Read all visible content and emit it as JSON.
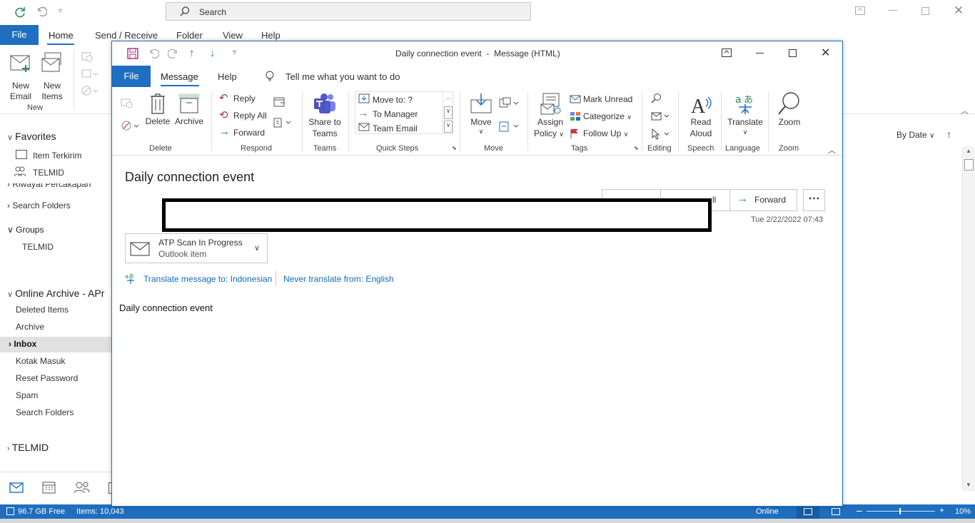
{
  "main": {
    "search_placeholder": "Search",
    "tabs": {
      "file": "File",
      "home": "Home",
      "send_receive": "Send / Receive",
      "folder": "Folder",
      "view": "View",
      "help": "Help"
    },
    "ribbon": {
      "new_email": [
        "New",
        "Email"
      ],
      "new_items": [
        "New",
        "Items"
      ],
      "group_new": "New"
    },
    "sort_label": "By Date"
  },
  "sidebar": {
    "favorites": "Favorites",
    "fav_items": [
      "Item Terkirim",
      "TELMID"
    ],
    "partial_item": "Riwayat Percakapan",
    "search_folders": "Search Folders",
    "groups": "Groups",
    "group_items": [
      "TELMID"
    ],
    "archive": "Online Archive - APr",
    "archive_items": [
      "Deleted Items",
      "Archive",
      "Inbox",
      "Kotak Masuk",
      "Reset Password",
      "Spam",
      "Search Folders"
    ],
    "telmid": "TELMID"
  },
  "statusbar": {
    "free": "96.7 GB Free",
    "items": "Items: 10,043",
    "online": "Online",
    "zoom": "10%"
  },
  "message": {
    "window_title": "Daily connection event  -  Message (HTML)",
    "tabs": {
      "file": "File",
      "message": "Message",
      "help": "Help",
      "tell_me": "Tell me what you want to do"
    },
    "ribbon": {
      "delete": "Delete",
      "archive": "Archive",
      "group_delete": "Delete",
      "reply": "Reply",
      "reply_all": "Reply All",
      "forward": "Forward",
      "group_respond": "Respond",
      "share_teams": [
        "Share to",
        "Teams"
      ],
      "group_teams": "Teams",
      "qs_items": [
        "Move to: ?",
        "To Manager",
        "Team Email"
      ],
      "group_quick_steps": "Quick Steps",
      "move": "Move",
      "group_move": "Move",
      "assign_policy": [
        "Assign",
        "Policy"
      ],
      "mark_unread": "Mark Unread",
      "categorize": "Categorize",
      "follow_up": "Follow Up",
      "group_tags": "Tags",
      "group_editing": "Editing",
      "read_aloud": [
        "Read",
        "Aloud"
      ],
      "group_speech": "Speech",
      "translate": "Translate",
      "group_language": "Language",
      "zoom": "Zoom",
      "group_zoom": "Zoom"
    },
    "subject": "Daily connection event",
    "header_buttons": {
      "reply_all_partial": "ll",
      "forward": "Forward"
    },
    "date": "Tue 2/22/2022 07:43",
    "attachment": {
      "name": "ATP Scan In Progress",
      "type": "Outlook item"
    },
    "translate_link": "Translate message to: Indonesian",
    "never_translate": "Never translate from: English",
    "body": "Daily connection event"
  }
}
